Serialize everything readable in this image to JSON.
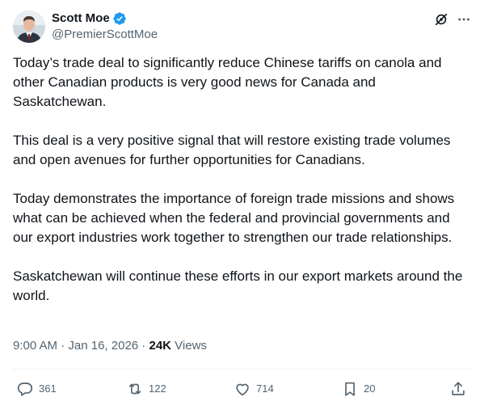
{
  "author": {
    "name": "Scott Moe",
    "handle": "@PremierScottMoe",
    "verified": true,
    "avatar": "profile-photo"
  },
  "colors": {
    "text": "#0f1419",
    "secondary": "#536471",
    "verified": "#1d9bf0",
    "divider": "#eff3f4"
  },
  "top_actions": [
    {
      "icon": "grok-icon"
    },
    {
      "icon": "more-icon"
    }
  ],
  "post": {
    "paragraphs": [
      "Today’s trade deal to significantly reduce Chinese tariffs on canola and other Canadian products is very good news for Canada and Saskatchewan.",
      "This deal is a very positive signal that will restore existing trade volumes and open avenues for further opportunities for Canadians.",
      "Today demonstrates the importance of foreign trade missions and shows what can be achieved when the federal and provincial governments and our export industries work together to strengthen our trade relationships.",
      "Saskatchewan will continue these efforts in our export markets around the world."
    ]
  },
  "meta": {
    "time": "9:00 AM",
    "separator1": " · ",
    "date": "Jan 16, 2026",
    "separator2": " · ",
    "views_count": "24K",
    "views_label": " Views"
  },
  "actions": {
    "reply": {
      "icon": "reply-icon",
      "count": "361"
    },
    "repost": {
      "icon": "repost-icon",
      "count": "122"
    },
    "like": {
      "icon": "heart-icon",
      "count": "714"
    },
    "bookmark": {
      "icon": "bookmark-icon",
      "count": "20"
    },
    "share": {
      "icon": "share-icon"
    }
  }
}
